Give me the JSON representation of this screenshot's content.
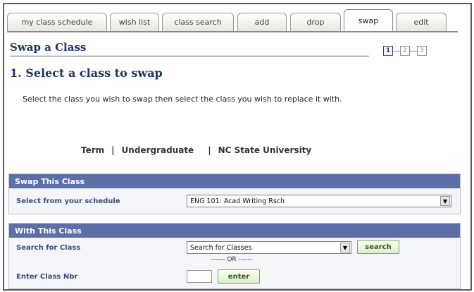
{
  "tabs": [
    {
      "label": "my class schedule"
    },
    {
      "label": "wish list"
    },
    {
      "label": "class search"
    },
    {
      "label": "add"
    },
    {
      "label": "drop"
    },
    {
      "label": "swap"
    },
    {
      "label": "edit"
    }
  ],
  "active_tab": "swap",
  "page_title": "Swap a Class",
  "steps": [
    "1",
    "2",
    "3"
  ],
  "section_title": "1.  Select a class to swap",
  "instructions": "Select the class you wish to swap then select the class you wish to replace it with.",
  "term": {
    "term_label": "Term",
    "sep1": "|",
    "career": "Undergraduate",
    "sep2": "|",
    "institution": "NC State University"
  },
  "swap_panel": {
    "header": "Swap This Class",
    "select_label": "Select from your schedule",
    "select_value": "ENG 101: Acad Writing Rsch"
  },
  "with_panel": {
    "header": "With This Class",
    "search_label": "Search for Class",
    "search_value": "Search for Classes",
    "search_button": "search",
    "or_text": "------ OR ------",
    "nbr_label": "Enter Class Nbr",
    "enter_button": "enter"
  },
  "colors": {
    "panel_header": "#5c6fa6",
    "title": "#1f3463",
    "button_text": "#2e5a1e"
  }
}
